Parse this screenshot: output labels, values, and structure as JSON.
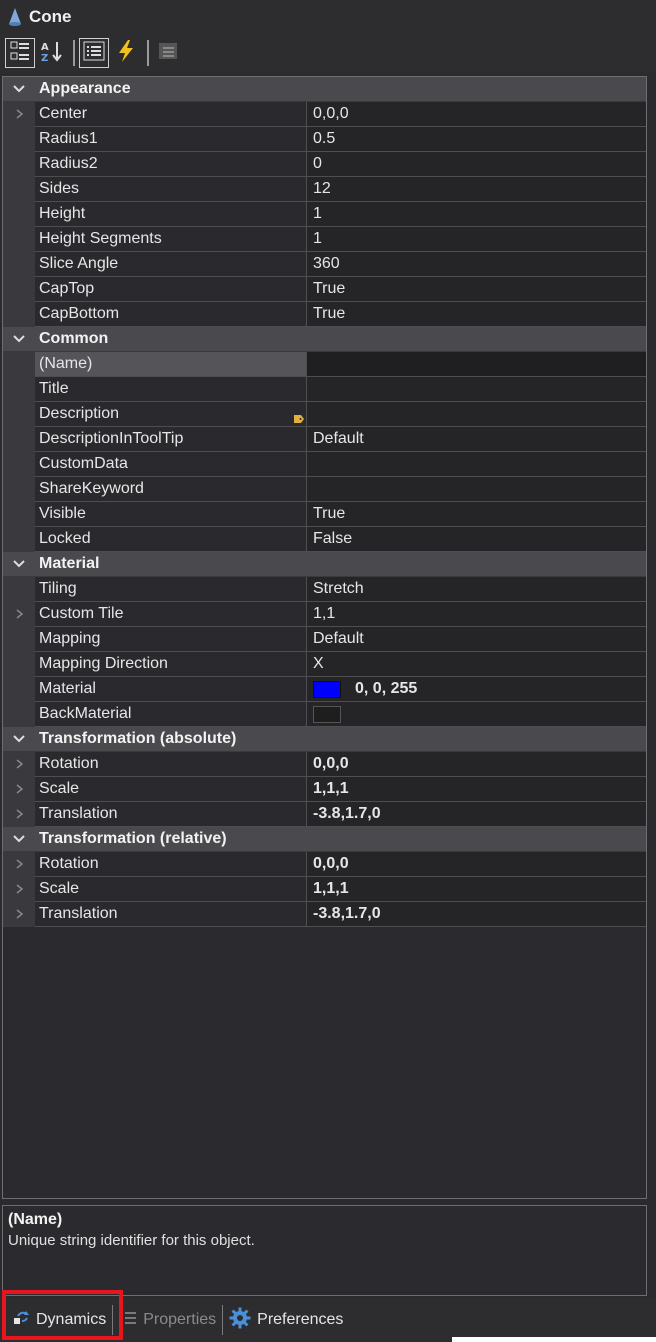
{
  "title": "Cone",
  "toolbar": {
    "buttons": [
      "categorized-icon",
      "alphabetical-icon",
      "properties-icon",
      "events-icon",
      "property-pages-icon"
    ]
  },
  "categories": {
    "appearance": {
      "label": "Appearance",
      "rows": [
        {
          "name": "Center",
          "value": "0,0,0",
          "expandable": true
        },
        {
          "name": "Radius1",
          "value": "0.5"
        },
        {
          "name": "Radius2",
          "value": "0"
        },
        {
          "name": "Sides",
          "value": "12"
        },
        {
          "name": "Height",
          "value": "1"
        },
        {
          "name": "Height Segments",
          "value": "1"
        },
        {
          "name": "Slice Angle",
          "value": "360"
        },
        {
          "name": "CapTop",
          "value": "True"
        },
        {
          "name": "CapBottom",
          "value": "True"
        }
      ]
    },
    "common": {
      "label": "Common",
      "rows": [
        {
          "name": "(Name)",
          "value": ""
        },
        {
          "name": "Title",
          "value": ""
        },
        {
          "name": "Description",
          "value": ""
        },
        {
          "name": "DescriptionInToolTip",
          "value": "Default"
        },
        {
          "name": "CustomData",
          "value": ""
        },
        {
          "name": "ShareKeyword",
          "value": ""
        },
        {
          "name": "Visible",
          "value": "True"
        },
        {
          "name": "Locked",
          "value": "False"
        }
      ]
    },
    "material": {
      "label": "Material",
      "rows": [
        {
          "name": "Tiling",
          "value": "Stretch"
        },
        {
          "name": "Custom Tile",
          "value": "1,1",
          "expandable": true
        },
        {
          "name": "Mapping",
          "value": "Default"
        },
        {
          "name": "Mapping Direction",
          "value": "X"
        },
        {
          "name": "Material",
          "value": "0, 0, 255",
          "color": "#0000ff"
        },
        {
          "name": "BackMaterial",
          "value": "",
          "color": "#1e1e1e"
        }
      ]
    },
    "transform_abs": {
      "label": "Transformation (absolute)",
      "rows": [
        {
          "name": "Rotation",
          "value": "0,0,0"
        },
        {
          "name": "Scale",
          "value": "1,1,1"
        },
        {
          "name": "Translation",
          "value": "-3.8,1.7,0"
        }
      ]
    },
    "transform_rel": {
      "label": "Transformation (relative)",
      "rows": [
        {
          "name": "Rotation",
          "value": "0,0,0"
        },
        {
          "name": "Scale",
          "value": "1,1,1"
        },
        {
          "name": "Translation",
          "value": "-3.8,1.7,0"
        }
      ]
    }
  },
  "description": {
    "title": "(Name)",
    "text": "Unique string identifier for this object."
  },
  "tabs": {
    "dynamics": "Dynamics",
    "properties": "Properties",
    "preferences": "Preferences"
  },
  "colors": {
    "highlight": "#e8151f",
    "material_swatch": "#0000ff"
  }
}
